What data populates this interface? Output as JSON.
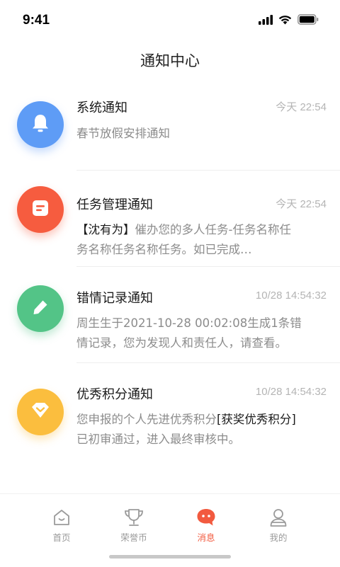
{
  "status_bar": {
    "time": "9:41"
  },
  "header": {
    "title": "通知中心"
  },
  "notices": [
    {
      "title": "系统通知",
      "time": "今天 22:54",
      "body": "春节放假安排通知",
      "icon": "bell-icon",
      "color": "#5e9cf6"
    },
    {
      "title": "任务管理通知",
      "time": "今天 22:54",
      "body_highlight": "【沈有为】",
      "body_line1_rest": "催办您的多人任务-任务名称任",
      "body_line2": "务名称任务名称任务。如已完成…",
      "icon": "task-doc-icon",
      "color": "#f65c3f"
    },
    {
      "title": "错情记录通知",
      "time": "10/28 14:54:32",
      "body_line1": "周生生于2021-10-28 00:02:08生成1条错",
      "body_line2": "情记录，您为发现人和责任人，请查看。",
      "icon": "pencil-icon",
      "color": "#53c487"
    },
    {
      "title": "优秀积分通知",
      "time": "10/28 14:54:32",
      "body_line1_pre": "您申报的个人先进优秀积分",
      "body_highlight": "[获奖优秀积分]",
      "body_line2": "已初审通过，进入最终审核中。",
      "icon": "diamond-icon",
      "color": "#fbbe3e"
    }
  ],
  "tab_bar": {
    "tabs": [
      {
        "label": "首页",
        "icon": "home-icon",
        "active": false
      },
      {
        "label": "荣誉币",
        "icon": "trophy-icon",
        "active": false
      },
      {
        "label": "消息",
        "icon": "message-icon",
        "active": true
      },
      {
        "label": "我的",
        "icon": "user-icon",
        "active": false
      }
    ]
  },
  "colors": {
    "accent": "#f25a3f",
    "inactive": "#9b9b9b"
  }
}
